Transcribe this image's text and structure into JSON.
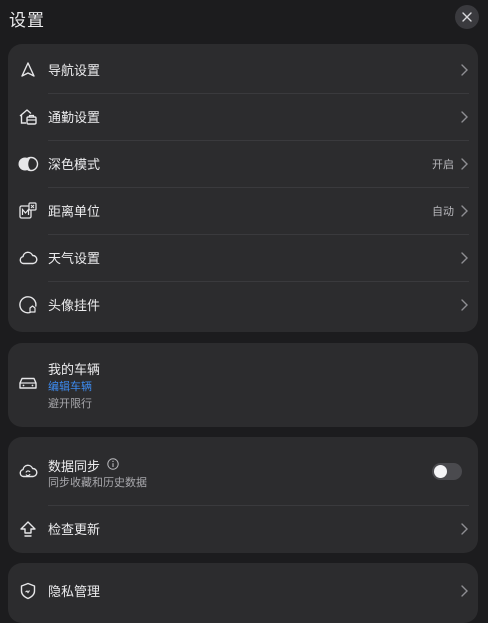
{
  "header": {
    "title": "设置"
  },
  "icons": {
    "close": "close-icon",
    "navigation": "navigation-arrow-icon",
    "commute": "home-briefcase-icon",
    "dark_mode": "half-circle-icon",
    "distance_unit": "metric-unit-icon",
    "weather": "cloud-icon",
    "avatar": "avatar-frame-icon",
    "vehicle": "car-icon",
    "sync": "cloud-sync-icon",
    "update": "upload-arrow-icon",
    "privacy": "shield-icon",
    "chevron": "chevron-right-icon",
    "info": "info-icon"
  },
  "settings": {
    "items": [
      {
        "label": "导航设置",
        "value": ""
      },
      {
        "label": "通勤设置",
        "value": ""
      },
      {
        "label": "深色模式",
        "value": "开启"
      },
      {
        "label": "距离单位",
        "value": "自动"
      },
      {
        "label": "天气设置",
        "value": ""
      },
      {
        "label": "头像挂件",
        "value": ""
      }
    ]
  },
  "vehicle": {
    "title": "我的车辆",
    "edit_label": "编辑车辆",
    "subtitle": "避开限行"
  },
  "sync": {
    "title": "数据同步",
    "subtitle": "同步收藏和历史数据",
    "enabled": false
  },
  "update": {
    "label": "检查更新"
  },
  "privacy": {
    "label": "隐私管理"
  },
  "colors": {
    "background": "#1c1c1e",
    "card": "#2c2c2e",
    "accent": "#3d8bf0",
    "text": "#ececee",
    "secondary_text": "#a8a8ac"
  }
}
